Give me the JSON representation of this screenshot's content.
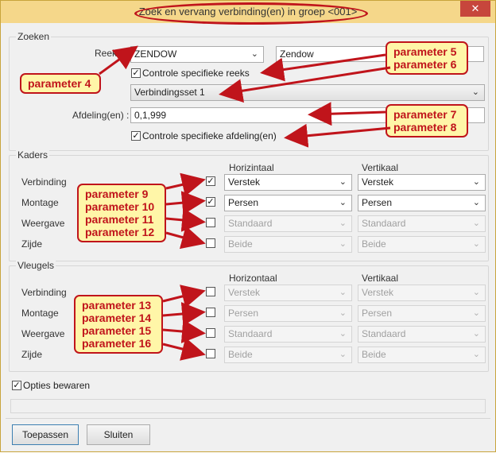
{
  "window": {
    "title": "Zoek en vervang verbinding(en) in groep <001>",
    "close_glyph": "✕"
  },
  "zoeken": {
    "legend": "Zoeken",
    "reeks_label": "Reeks :",
    "reeks_value": "ZENDOW",
    "reeks_name": "Zendow",
    "controle_reeks_label": "Controle specifieke reeks",
    "controle_reeks_checked": true,
    "verbindingsset_value": "Verbindingsset 1",
    "afdeling_label": "Afdeling(en) :",
    "afdeling_value": "0,1,999",
    "controle_afdeling_label": "Controle specifieke afdeling(en)",
    "controle_afdeling_checked": true
  },
  "kaders": {
    "legend": "Kaders",
    "col_horizontaal": "Horizintaal",
    "col_vertikaal": "Vertikaal",
    "rows": [
      {
        "label": "Verbinding",
        "checked": true,
        "h": "Verstek",
        "v": "Verstek",
        "enabled": true
      },
      {
        "label": "Montage",
        "checked": true,
        "h": "Persen",
        "v": "Persen",
        "enabled": true
      },
      {
        "label": "Weergave",
        "checked": false,
        "h": "Standaard",
        "v": "Standaard",
        "enabled": false
      },
      {
        "label": "Zijde",
        "checked": false,
        "h": "Beide",
        "v": "Beide",
        "enabled": false
      }
    ]
  },
  "vleugels": {
    "legend": "Vleugels",
    "col_horizontaal": "Horizontaal",
    "col_vertikaal": "Vertikaal",
    "rows": [
      {
        "label": "Verbinding",
        "checked": false,
        "h": "Verstek",
        "v": "Verstek",
        "enabled": false
      },
      {
        "label": "Montage",
        "checked": false,
        "h": "Persen",
        "v": "Persen",
        "enabled": false
      },
      {
        "label": "Weergave",
        "checked": false,
        "h": "Standaard",
        "v": "Standaard",
        "enabled": false
      },
      {
        "label": "Zijde",
        "checked": false,
        "h": "Beide",
        "v": "Beide",
        "enabled": false
      }
    ]
  },
  "opties_bewaren": {
    "label": "Opties bewaren",
    "checked": true
  },
  "buttons": {
    "apply": "Toepassen",
    "close": "Sluiten"
  },
  "callouts": {
    "p4": "parameter 4",
    "p5": "parameter 5",
    "p6": "parameter 6",
    "p7": "parameter 7",
    "p8": "parameter 8",
    "p9": "parameter 9",
    "p10": "parameter 10",
    "p11": "parameter 11",
    "p12": "parameter 12",
    "p13": "parameter 13",
    "p14": "parameter 14",
    "p15": "parameter 15",
    "p16": "parameter 16"
  },
  "colors": {
    "annotation_red": "#c0141b",
    "callout_fill": "#fff6a8",
    "titlebar": "#f5d78a"
  }
}
